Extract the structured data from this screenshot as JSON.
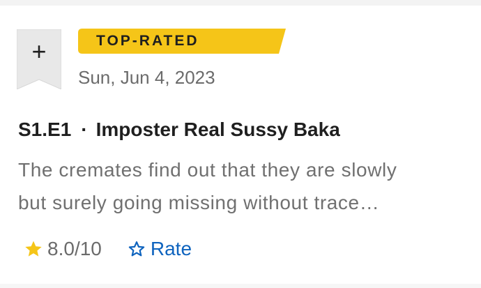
{
  "watchlist": {
    "symbol": "+",
    "ribbon_color": "#e8e8e8",
    "icon": "plus-icon"
  },
  "badge": {
    "label": "TOP-RATED",
    "color": "#f5c518"
  },
  "episode": {
    "date": "Sun, Jun 4, 2023",
    "number": "S1.E1",
    "separator": "·",
    "title": "Imposter Real Sussy Baka",
    "plot_line1": "The cremates find out that they are slowly",
    "plot_line2": "but surely going missing without trace…"
  },
  "rating": {
    "value": "8.0",
    "max": "/10",
    "star_color": "#f5c518",
    "icon": "star-filled-icon"
  },
  "rate": {
    "label": "Rate",
    "color": "#0e63be",
    "icon": "star-outline-icon"
  }
}
